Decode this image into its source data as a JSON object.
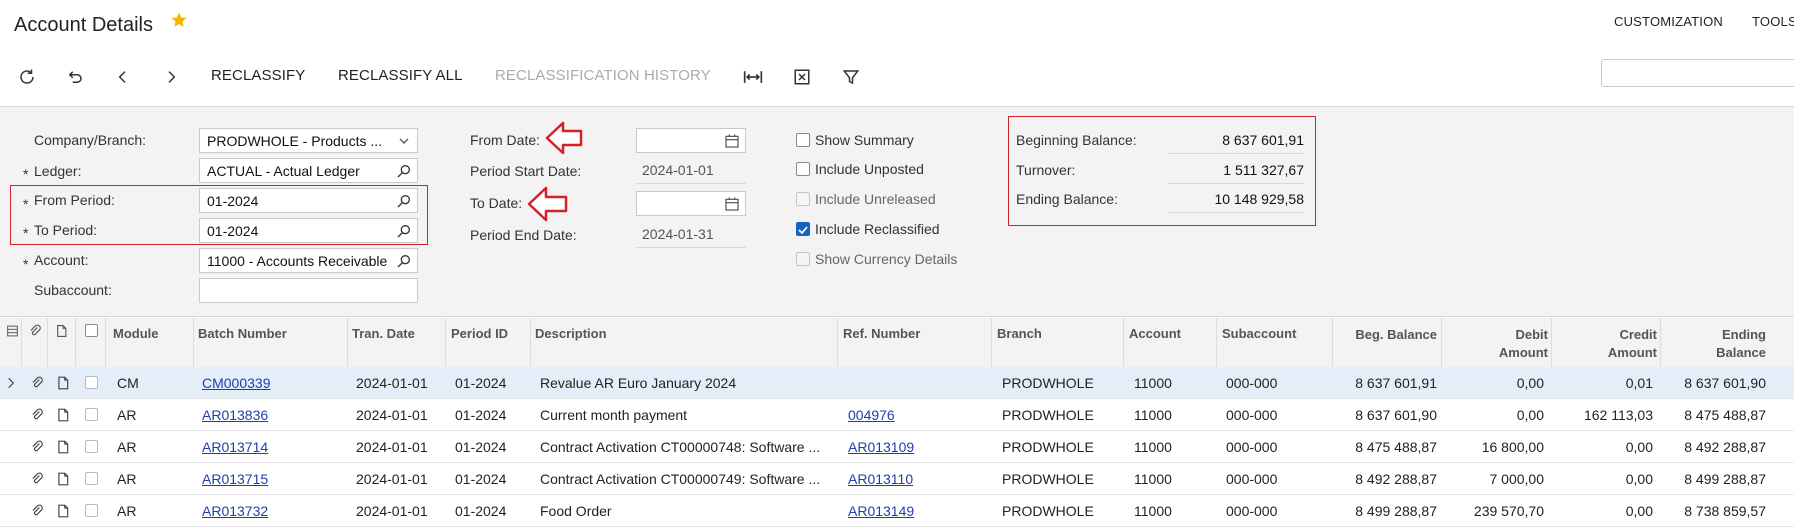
{
  "header": {
    "title": "Account Details",
    "links": [
      "CUSTOMIZATION",
      "TOOLS"
    ]
  },
  "toolbar": {
    "icons": [
      "refresh-icon",
      "undo-icon",
      "chevron-left-icon",
      "chevron-right-icon"
    ],
    "reclassify": "RECLASSIFY",
    "reclassify_all": "RECLASSIFY ALL",
    "reclassification_history": "RECLASSIFICATION HISTORY",
    "right_icons": [
      "fit-columns-icon",
      "excel-export-icon",
      "filter-icon"
    ],
    "search_placeholder": ""
  },
  "form": {
    "company_branch": {
      "label": "Company/Branch:",
      "value": "PRODWHOLE - Products ..."
    },
    "ledger": {
      "label": "Ledger:",
      "value": "ACTUAL - Actual Ledger"
    },
    "from_period": {
      "label": "From Period:",
      "value": "01-2024"
    },
    "to_period": {
      "label": "To Period:",
      "value": "01-2024"
    },
    "account": {
      "label": "Account:",
      "value": "11000 - Accounts Receivable"
    },
    "subaccount": {
      "label": "Subaccount:",
      "value": ""
    },
    "required_mark": "*",
    "from_date": {
      "label": "From Date:",
      "value": ""
    },
    "period_start_date": {
      "label": "Period Start Date:",
      "value": "2024-01-01"
    },
    "to_date": {
      "label": "To Date:",
      "value": ""
    },
    "period_end_date": {
      "label": "Period End Date:",
      "value": "2024-01-31"
    },
    "checkboxes": [
      {
        "label": "Show Summary",
        "checked": false,
        "disabled": false
      },
      {
        "label": "Include Unposted",
        "checked": false,
        "disabled": false
      },
      {
        "label": "Include Unreleased",
        "checked": false,
        "disabled": true
      },
      {
        "label": "Include Reclassified",
        "checked": true,
        "disabled": false
      },
      {
        "label": "Show Currency Details",
        "checked": false,
        "disabled": true
      }
    ],
    "balances": {
      "beginning": {
        "label": "Beginning Balance:",
        "value": "8 637 601,91"
      },
      "turnover": {
        "label": "Turnover:",
        "value": "1 511 327,67"
      },
      "ending": {
        "label": "Ending Balance:",
        "value": "10 148 929,58"
      }
    }
  },
  "grid": {
    "columns": {
      "module": "Module",
      "batch_number": "Batch Number",
      "tran_date": "Tran. Date",
      "period_id": "Period ID",
      "description": "Description",
      "ref_number": "Ref. Number",
      "branch": "Branch",
      "account": "Account",
      "subaccount": "Subaccount",
      "beg_balance": "Beg. Balance",
      "debit_amount_1": "Debit",
      "debit_amount_2": "Amount",
      "credit_amount_1": "Credit",
      "credit_amount_2": "Amount",
      "ending_balance_1": "Ending",
      "ending_balance_2": "Balance"
    },
    "rows": [
      {
        "module": "CM",
        "batch": "CM000339",
        "date": "2024-01-01",
        "period": "01-2024",
        "description": "Revalue AR Euro January 2024",
        "ref": "",
        "branch": "PRODWHOLE",
        "account": "11000",
        "subaccount": "000-000",
        "beg": "8 637 601,91",
        "debit": "0,00",
        "credit": "0,01",
        "ending": "8 637 601,90"
      },
      {
        "module": "AR",
        "batch": "AR013836",
        "date": "2024-01-01",
        "period": "01-2024",
        "description": "Current month payment",
        "ref": "004976",
        "branch": "PRODWHOLE",
        "account": "11000",
        "subaccount": "000-000",
        "beg": "8 637 601,90",
        "debit": "0,00",
        "credit": "162 113,03",
        "ending": "8 475 488,87"
      },
      {
        "module": "AR",
        "batch": "AR013714",
        "date": "2024-01-01",
        "period": "01-2024",
        "description": "Contract Activation CT00000748: Software ...",
        "ref": "AR013109",
        "branch": "PRODWHOLE",
        "account": "11000",
        "subaccount": "000-000",
        "beg": "8 475 488,87",
        "debit": "16 800,00",
        "credit": "0,00",
        "ending": "8 492 288,87"
      },
      {
        "module": "AR",
        "batch": "AR013715",
        "date": "2024-01-01",
        "period": "01-2024",
        "description": "Contract Activation CT00000749: Software ...",
        "ref": "AR013110",
        "branch": "PRODWHOLE",
        "account": "11000",
        "subaccount": "000-000",
        "beg": "8 492 288,87",
        "debit": "7 000,00",
        "credit": "0,00",
        "ending": "8 499 288,87"
      },
      {
        "module": "AR",
        "batch": "AR013732",
        "date": "2024-01-01",
        "period": "01-2024",
        "description": "Food Order",
        "ref": "AR013149",
        "branch": "PRODWHOLE",
        "account": "11000",
        "subaccount": "000-000",
        "beg": "8 499 288,87",
        "debit": "239 570,70",
        "credit": "0,00",
        "ending": "8 738 859,57"
      }
    ]
  },
  "colors": {
    "accent_star": "#f5b400",
    "highlight_red": "#d2232a",
    "link_blue": "#1c3fb0",
    "checkbox_blue": "#1565c0",
    "selected_row": "#e4eef9"
  }
}
